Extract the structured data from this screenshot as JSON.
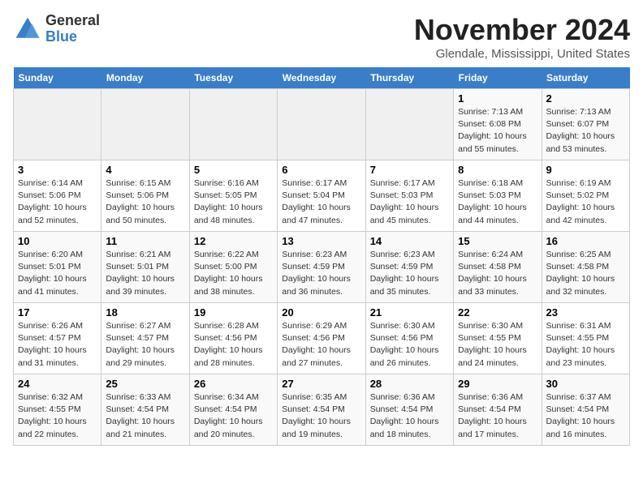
{
  "header": {
    "logo_line1": "General",
    "logo_line2": "Blue",
    "title": "November 2024",
    "subtitle": "Glendale, Mississippi, United States"
  },
  "weekdays": [
    "Sunday",
    "Monday",
    "Tuesday",
    "Wednesday",
    "Thursday",
    "Friday",
    "Saturday"
  ],
  "weeks": [
    [
      {
        "day": "",
        "info": ""
      },
      {
        "day": "",
        "info": ""
      },
      {
        "day": "",
        "info": ""
      },
      {
        "day": "",
        "info": ""
      },
      {
        "day": "",
        "info": ""
      },
      {
        "day": "1",
        "info": "Sunrise: 7:13 AM\nSunset: 6:08 PM\nDaylight: 10 hours\nand 55 minutes."
      },
      {
        "day": "2",
        "info": "Sunrise: 7:13 AM\nSunset: 6:07 PM\nDaylight: 10 hours\nand 53 minutes."
      }
    ],
    [
      {
        "day": "3",
        "info": "Sunrise: 6:14 AM\nSunset: 5:06 PM\nDaylight: 10 hours\nand 52 minutes."
      },
      {
        "day": "4",
        "info": "Sunrise: 6:15 AM\nSunset: 5:06 PM\nDaylight: 10 hours\nand 50 minutes."
      },
      {
        "day": "5",
        "info": "Sunrise: 6:16 AM\nSunset: 5:05 PM\nDaylight: 10 hours\nand 48 minutes."
      },
      {
        "day": "6",
        "info": "Sunrise: 6:17 AM\nSunset: 5:04 PM\nDaylight: 10 hours\nand 47 minutes."
      },
      {
        "day": "7",
        "info": "Sunrise: 6:17 AM\nSunset: 5:03 PM\nDaylight: 10 hours\nand 45 minutes."
      },
      {
        "day": "8",
        "info": "Sunrise: 6:18 AM\nSunset: 5:03 PM\nDaylight: 10 hours\nand 44 minutes."
      },
      {
        "day": "9",
        "info": "Sunrise: 6:19 AM\nSunset: 5:02 PM\nDaylight: 10 hours\nand 42 minutes."
      }
    ],
    [
      {
        "day": "10",
        "info": "Sunrise: 6:20 AM\nSunset: 5:01 PM\nDaylight: 10 hours\nand 41 minutes."
      },
      {
        "day": "11",
        "info": "Sunrise: 6:21 AM\nSunset: 5:01 PM\nDaylight: 10 hours\nand 39 minutes."
      },
      {
        "day": "12",
        "info": "Sunrise: 6:22 AM\nSunset: 5:00 PM\nDaylight: 10 hours\nand 38 minutes."
      },
      {
        "day": "13",
        "info": "Sunrise: 6:23 AM\nSunset: 4:59 PM\nDaylight: 10 hours\nand 36 minutes."
      },
      {
        "day": "14",
        "info": "Sunrise: 6:23 AM\nSunset: 4:59 PM\nDaylight: 10 hours\nand 35 minutes."
      },
      {
        "day": "15",
        "info": "Sunrise: 6:24 AM\nSunset: 4:58 PM\nDaylight: 10 hours\nand 33 minutes."
      },
      {
        "day": "16",
        "info": "Sunrise: 6:25 AM\nSunset: 4:58 PM\nDaylight: 10 hours\nand 32 minutes."
      }
    ],
    [
      {
        "day": "17",
        "info": "Sunrise: 6:26 AM\nSunset: 4:57 PM\nDaylight: 10 hours\nand 31 minutes."
      },
      {
        "day": "18",
        "info": "Sunrise: 6:27 AM\nSunset: 4:57 PM\nDaylight: 10 hours\nand 29 minutes."
      },
      {
        "day": "19",
        "info": "Sunrise: 6:28 AM\nSunset: 4:56 PM\nDaylight: 10 hours\nand 28 minutes."
      },
      {
        "day": "20",
        "info": "Sunrise: 6:29 AM\nSunset: 4:56 PM\nDaylight: 10 hours\nand 27 minutes."
      },
      {
        "day": "21",
        "info": "Sunrise: 6:30 AM\nSunset: 4:56 PM\nDaylight: 10 hours\nand 26 minutes."
      },
      {
        "day": "22",
        "info": "Sunrise: 6:30 AM\nSunset: 4:55 PM\nDaylight: 10 hours\nand 24 minutes."
      },
      {
        "day": "23",
        "info": "Sunrise: 6:31 AM\nSunset: 4:55 PM\nDaylight: 10 hours\nand 23 minutes."
      }
    ],
    [
      {
        "day": "24",
        "info": "Sunrise: 6:32 AM\nSunset: 4:55 PM\nDaylight: 10 hours\nand 22 minutes."
      },
      {
        "day": "25",
        "info": "Sunrise: 6:33 AM\nSunset: 4:54 PM\nDaylight: 10 hours\nand 21 minutes."
      },
      {
        "day": "26",
        "info": "Sunrise: 6:34 AM\nSunset: 4:54 PM\nDaylight: 10 hours\nand 20 minutes."
      },
      {
        "day": "27",
        "info": "Sunrise: 6:35 AM\nSunset: 4:54 PM\nDaylight: 10 hours\nand 19 minutes."
      },
      {
        "day": "28",
        "info": "Sunrise: 6:36 AM\nSunset: 4:54 PM\nDaylight: 10 hours\nand 18 minutes."
      },
      {
        "day": "29",
        "info": "Sunrise: 6:36 AM\nSunset: 4:54 PM\nDaylight: 10 hours\nand 17 minutes."
      },
      {
        "day": "30",
        "info": "Sunrise: 6:37 AM\nSunset: 4:54 PM\nDaylight: 10 hours\nand 16 minutes."
      }
    ]
  ]
}
